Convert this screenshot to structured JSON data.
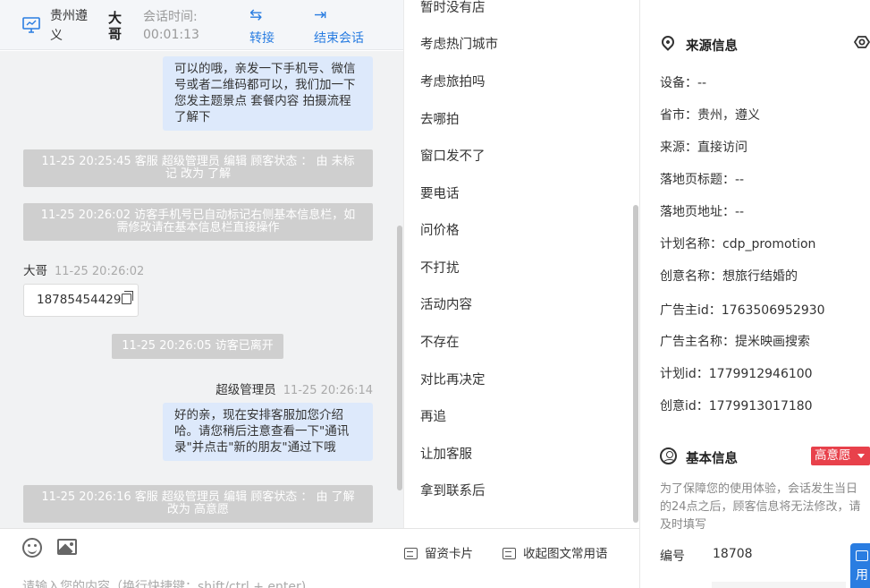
{
  "header": {
    "location": "贵州遵义",
    "customer_name": "大哥",
    "session_time_label": "会话时间:",
    "session_time": "00:01:13",
    "transfer_label": "转接",
    "end_label": "结束会话"
  },
  "messages": {
    "agent_msg_1": "可以的哦，亲发一下手机号、微信号或者二维码都可以，我们加一下您发主题景点 套餐内容 拍摄流程了解下",
    "sys_1": "11-25 20:25:45 客服 超级管理员 编辑 顾客状态 ： 由 未标记 改为 了解",
    "sys_2": "11-25 20:26:02 访客手机号已自动标记右侧基本信息栏，如需修改请在基本信息栏直接操作",
    "visitor_name": "大哥",
    "visitor_time": "11-25 20:26:02",
    "visitor_phone": "18785454429",
    "sys_left": "11-25 20:26:05 访客已离开",
    "agent_name": "超级管理员",
    "agent_time": "11-25 20:26:14",
    "agent_msg_2": "好的亲，现在安排客服加您介绍哈。请您稍后注意查看一下\"通讯录\"并点击\"新的朋友\"通过下哦",
    "sys_3": "11-25 20:26:16 客服 超级管理员 编辑 顾客状态 ： 由 了解 改为 高意愿"
  },
  "input": {
    "placeholder": "请输入您的内容（换行快捷键：shift/ctrl + enter)",
    "card_label": "留资卡片",
    "phrases_label": "收起图文常用语"
  },
  "phrases": [
    "暂时没有店",
    "考虑热门城市",
    "考虑旅拍吗",
    "去哪拍",
    "窗口发不了",
    "要电话",
    "问价格",
    "不打扰",
    "活动内容",
    "不存在",
    "对比再决定",
    "再追",
    "让加客服",
    "拿到联系后"
  ],
  "source_info": {
    "title": "来源信息",
    "rows": [
      "设备：--",
      "省市：贵州，遵义",
      "来源：直接访问",
      "落地页标题：--",
      "落地页地址：--",
      "计划名称：cdp_promotion",
      "创意名称：想旅行结婚的",
      "广告主id：1763506952930",
      "广告主名称：提米映画搜索",
      "计划id：1779912946100",
      "创意id：1779913017180"
    ]
  },
  "basic_info": {
    "title": "基本信息",
    "intent_tag": "高意愿",
    "notice": "为了保障您的使用体验，会话发生当日的24点之后，顾客信息将无法修改，请及时填写",
    "id_label": "编号",
    "id_value": "18708",
    "float_label": "用"
  },
  "colors": {
    "accent": "#2a7de1",
    "bubble": "#dde9fb",
    "system": "#cfcfcf",
    "tag": "#e8414b"
  }
}
